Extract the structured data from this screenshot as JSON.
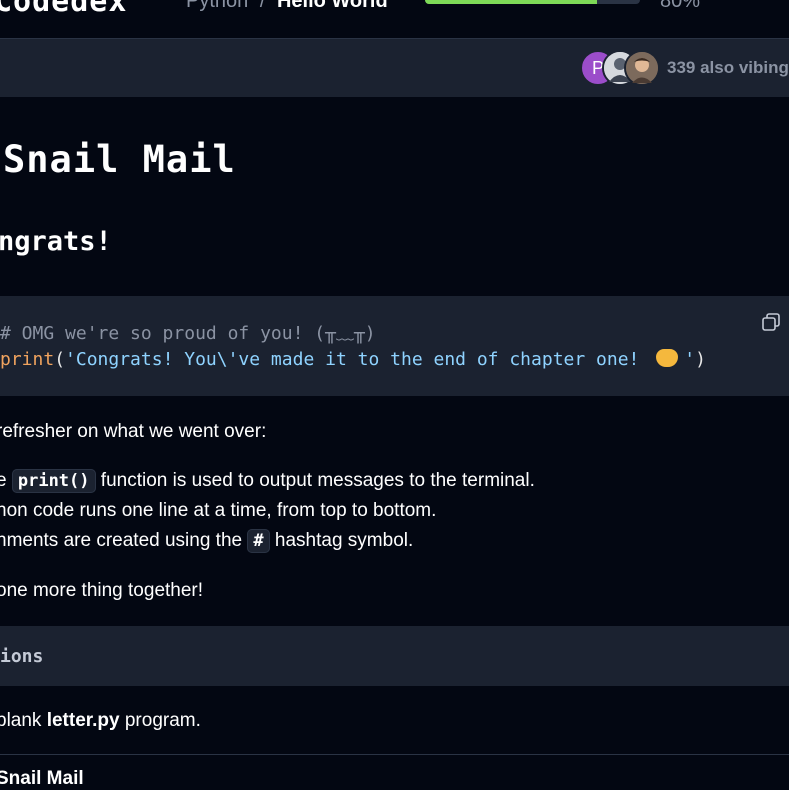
{
  "header": {
    "logo": "Codedex",
    "breadcrumb": {
      "course": "Python",
      "separator": "/",
      "chapter": "Hello World"
    },
    "progress": {
      "percent": 80,
      "label": "80%",
      "fill_color": "#7ed957"
    }
  },
  "community": {
    "avatar_initial": "P",
    "text": "339 also vibing"
  },
  "lesson": {
    "title": "Snail Mail",
    "subtitle": "ngrats!"
  },
  "code": {
    "comment": "# OMG we're so proud of you! (╥﹏╥)",
    "keyword": "print",
    "open": "(",
    "string_before_emoji": "'Congrats! You\\'ve made it to the end of chapter one! ",
    "string_after_emoji": "'",
    "close": ")",
    "copy_icon": "copy-icon"
  },
  "body": {
    "intro": "refresher on what we went over:",
    "bullet1_prefix": "e ",
    "bullet1_code": "print()",
    "bullet1_suffix": " function is used to output messages to the terminal.",
    "bullet2": "hon code runs one line at a time, from top to bottom.",
    "bullet3_prefix": "nments are created using the ",
    "bullet3_code": "#",
    "bullet3_suffix": " hashtag symbol.",
    "outro": "one more thing together!"
  },
  "instructions": {
    "heading": "ions",
    "step_prefix": "blank ",
    "step_file": "letter.py",
    "step_suffix": " program.",
    "next_title": "Snail Mail"
  }
}
